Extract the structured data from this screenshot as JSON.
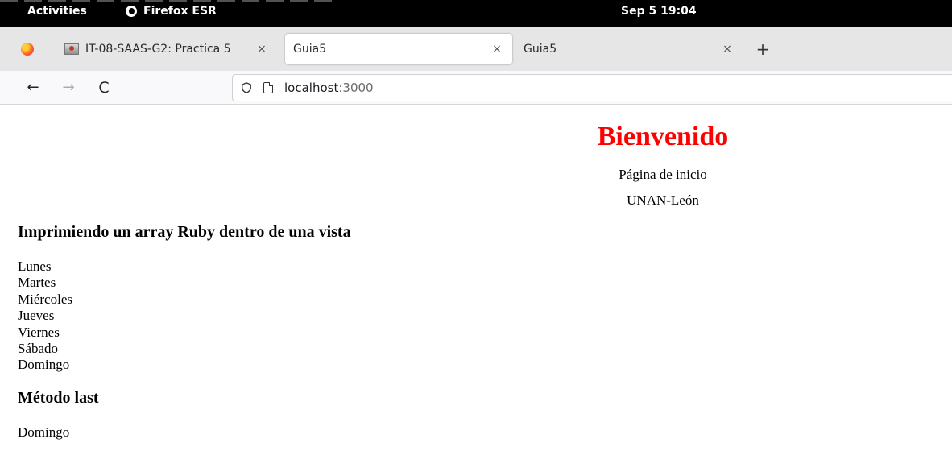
{
  "system_bar": {
    "activities": "Activities",
    "app_name": "Firefox ESR",
    "clock": "Sep 5  19:04"
  },
  "tabs": [
    {
      "label": "IT-08-SAAS-G2: Practica 5",
      "close": "×",
      "active": false
    },
    {
      "label": "Guia5",
      "close": "×",
      "active": true
    },
    {
      "label": "Guia5",
      "close": "×",
      "active": false
    }
  ],
  "new_tab": "+",
  "nav": {
    "back": "←",
    "forward": "→",
    "reload": "C"
  },
  "url": {
    "host": "localhost",
    "port": ":3000"
  },
  "page": {
    "heading": "Bienvenido",
    "subtitle": "Página de inicio",
    "institution": "UNAN-León",
    "section_array_title": "Imprimiendo un array Ruby dentro de una vista",
    "days": [
      "Lunes",
      "Martes",
      "Miércoles",
      "Jueves",
      "Viernes",
      "Sábado",
      "Domingo"
    ],
    "section_last_title": "Método last",
    "last_value": "Domingo"
  },
  "colors": {
    "heading": "#ff0000",
    "topbar": "#000000",
    "tabstrip": "#e6e6e6"
  },
  "icons": {
    "firefox_menu": "firefox-icon",
    "tab1_favicon": "moodle-favicon-icon",
    "tracking": "shield-icon",
    "page": "page-icon"
  }
}
